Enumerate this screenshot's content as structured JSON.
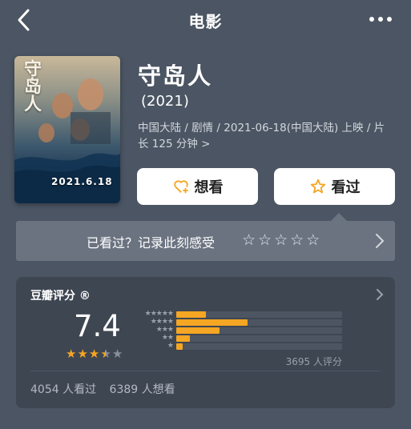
{
  "header": {
    "title": "电影",
    "back_icon": "chevron-left-icon",
    "more_icon": "more-dots-icon"
  },
  "poster": {
    "title_text": "守岛人",
    "date_text": "2021.6.18"
  },
  "movie": {
    "title": "守岛人",
    "year": "(2021)",
    "meta": "中国大陆 / 剧情 / 2021-06-18(中国大陆) 上映 / 片长 125 分钟 >"
  },
  "actions": {
    "want_label": "想看",
    "seen_label": "看过",
    "want_icon": "heart-plus-icon",
    "seen_icon": "star-icon",
    "seen_icon_color": "#f5a623"
  },
  "watched_prompt": {
    "text": "已看过？记录此刻感受",
    "stars": [
      "☆",
      "☆",
      "☆",
      "☆",
      "☆"
    ]
  },
  "rating": {
    "title": "豆瓣评分 ®",
    "score": "7.4",
    "stars": 3.5,
    "star_color": "#f5a623",
    "distribution": [
      {
        "stars_text": "★★★★★",
        "fraction": 0.18
      },
      {
        "stars_text": "★★★★",
        "fraction": 0.43
      },
      {
        "stars_text": "★★★",
        "fraction": 0.26
      },
      {
        "stars_text": "★★",
        "fraction": 0.08
      },
      {
        "stars_text": "★",
        "fraction": 0.04
      }
    ],
    "count": "3695 人评分",
    "watched": "4054 人看过",
    "want": "6389 人想看"
  },
  "colors": {
    "background": "#4b5563",
    "card": "#3e4652",
    "accent": "#f5a623"
  }
}
